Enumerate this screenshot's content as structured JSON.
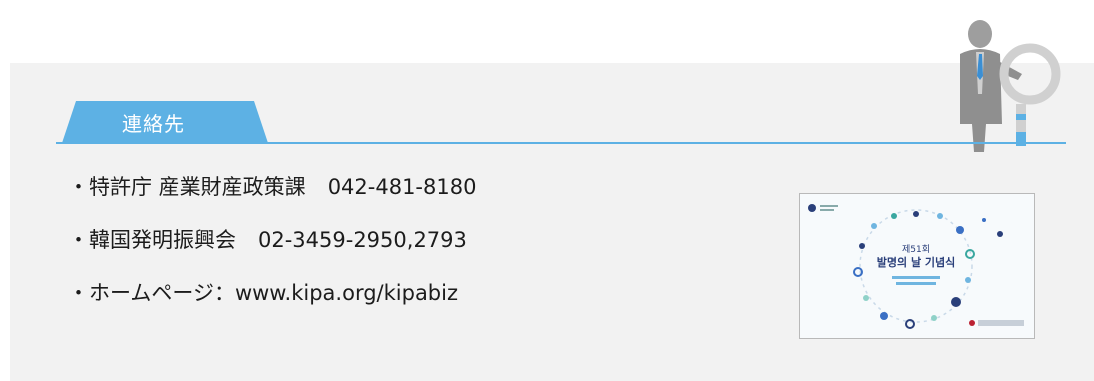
{
  "section": {
    "tab_label": "連絡先"
  },
  "contacts": [
    {
      "prefix": "・特許庁 産業財産政策課",
      "value": "042-481-8180"
    },
    {
      "prefix": "・韓国発明振興会",
      "value": "02-3459-2950,2793"
    },
    {
      "prefix": "・ホームページ：",
      "value": "www.kipa.org/kipabiz"
    }
  ],
  "poster": {
    "title_line1": "제51회",
    "title_line2": "발명의 날 기념식"
  },
  "colors": {
    "accent": "#5db1e4",
    "panel": "#f2f2f2",
    "text": "#1c1c1c"
  },
  "icons": {
    "mascot": "person-with-magnifier-icon"
  }
}
